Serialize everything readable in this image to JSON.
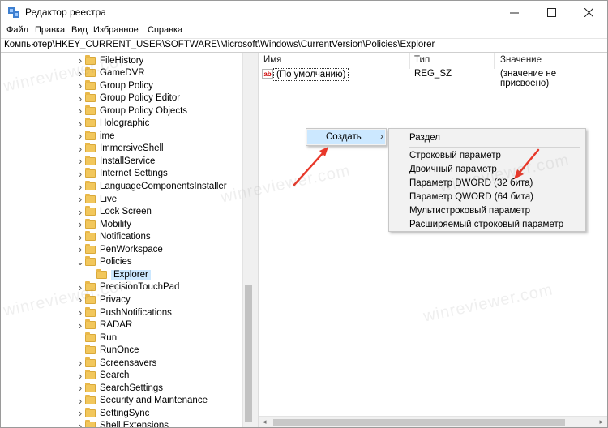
{
  "window": {
    "title": "Редактор реестра"
  },
  "menubar": [
    "Файл",
    "Правка",
    "Вид",
    "Избранное",
    "Справка"
  ],
  "address": "Компьютер\\HKEY_CURRENT_USER\\SOFTWARE\\Microsoft\\Windows\\CurrentVersion\\Policies\\Explorer",
  "tree": [
    {
      "label": "FileHistory",
      "state": "collapsed",
      "indent": 0
    },
    {
      "label": "GameDVR",
      "state": "collapsed",
      "indent": 0
    },
    {
      "label": "Group Policy",
      "state": "collapsed",
      "indent": 0
    },
    {
      "label": "Group Policy Editor",
      "state": "collapsed",
      "indent": 0
    },
    {
      "label": "Group Policy Objects",
      "state": "collapsed",
      "indent": 0
    },
    {
      "label": "Holographic",
      "state": "collapsed",
      "indent": 0
    },
    {
      "label": "ime",
      "state": "collapsed",
      "indent": 0
    },
    {
      "label": "ImmersiveShell",
      "state": "collapsed",
      "indent": 0
    },
    {
      "label": "InstallService",
      "state": "collapsed",
      "indent": 0
    },
    {
      "label": "Internet Settings",
      "state": "collapsed",
      "indent": 0
    },
    {
      "label": "LanguageComponentsInstaller",
      "state": "collapsed",
      "indent": 0
    },
    {
      "label": "Live",
      "state": "collapsed",
      "indent": 0
    },
    {
      "label": "Lock Screen",
      "state": "collapsed",
      "indent": 0
    },
    {
      "label": "Mobility",
      "state": "collapsed",
      "indent": 0
    },
    {
      "label": "Notifications",
      "state": "collapsed",
      "indent": 0
    },
    {
      "label": "PenWorkspace",
      "state": "collapsed",
      "indent": 0
    },
    {
      "label": "Policies",
      "state": "expanded",
      "indent": 0
    },
    {
      "label": "Explorer",
      "state": "none",
      "indent": 1,
      "selected": true
    },
    {
      "label": "PrecisionTouchPad",
      "state": "collapsed",
      "indent": 0
    },
    {
      "label": "Privacy",
      "state": "collapsed",
      "indent": 0
    },
    {
      "label": "PushNotifications",
      "state": "collapsed",
      "indent": 0
    },
    {
      "label": "RADAR",
      "state": "collapsed",
      "indent": 0
    },
    {
      "label": "Run",
      "state": "none",
      "indent": 0
    },
    {
      "label": "RunOnce",
      "state": "none",
      "indent": 0
    },
    {
      "label": "Screensavers",
      "state": "collapsed",
      "indent": 0
    },
    {
      "label": "Search",
      "state": "collapsed",
      "indent": 0
    },
    {
      "label": "SearchSettings",
      "state": "collapsed",
      "indent": 0
    },
    {
      "label": "Security and Maintenance",
      "state": "collapsed",
      "indent": 0
    },
    {
      "label": "SettingSync",
      "state": "collapsed",
      "indent": 0
    },
    {
      "label": "Shell Extensions",
      "state": "collapsed",
      "indent": 0
    }
  ],
  "list": {
    "columns": [
      "Имя",
      "Тип",
      "Значение"
    ],
    "rows": [
      {
        "name": "(По умолчанию)",
        "type": "REG_SZ",
        "value": "(значение не присвоено)",
        "icon": "string-value-icon"
      }
    ]
  },
  "context_menu": {
    "create_label": "Создать",
    "arrow": "›"
  },
  "submenu": {
    "items": [
      "Раздел",
      "Строковый параметр",
      "Двоичный параметр",
      "Параметр DWORD (32 бита)",
      "Параметр QWORD (64 бита)",
      "Мультистроковый параметр",
      "Расширяемый строковый параметр"
    ]
  },
  "watermark_text": "winreviewer.com",
  "colors": {
    "menu_highlight": "#cce8ff",
    "selected_item": "#cce8ff",
    "arrow_red": "#e8382a",
    "folder": "#f2c75c"
  }
}
